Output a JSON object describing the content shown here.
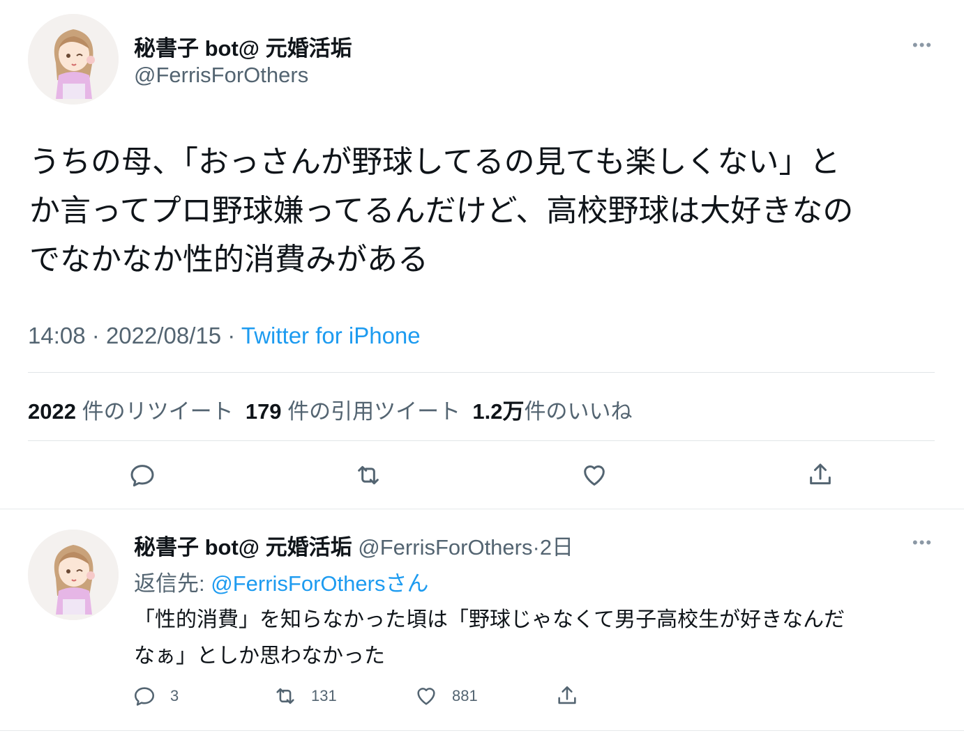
{
  "tweet": {
    "author_name": "秘書子 bot@ 元婚活垢",
    "author_handle": "@FerrisForOthers",
    "more_label": "•••",
    "text_lines": [
      "うちの母、「おっさんが野球してるの見ても楽しくない」と",
      "か言ってプロ野球嫌ってるんだけど、高校野球は大好きなの",
      "でなかなか性的消費みがある"
    ],
    "time": "14:08",
    "date": "2022/08/15",
    "separator": "·",
    "source": "Twitter for iPhone",
    "stats": {
      "retweets_count": "2022",
      "retweets_label": "件のリツイート",
      "quotes_count": "179",
      "quotes_label": "件の引用ツイート",
      "likes_count": "1.2万",
      "likes_label": "件のいいね"
    },
    "actions": {
      "reply_icon": "reply-icon",
      "retweet_icon": "retweet-icon",
      "like_icon": "heart-icon",
      "share_icon": "share-icon"
    }
  },
  "reply": {
    "author_name": "秘書子 bot@ 元婚活垢",
    "author_handle": "@FerrisForOthers",
    "separator": "·",
    "age": "2日",
    "more_label": "•••",
    "reply_to_prefix": "返信先: ",
    "reply_to_handle": "@FerrisForOthers",
    "reply_to_suffix": "さん",
    "text_lines": [
      "「性的消費」を知らなかった頃は「野球じゃなくて男子高校生が好きなんだ",
      "なぁ」としか思わなかった"
    ],
    "reply_count": "3",
    "retweet_count": "131",
    "like_count": "881"
  },
  "colors": {
    "text": "#0f1419",
    "secondary": "#536471",
    "link": "#1d9bf0",
    "divider": "#e1e5e8"
  }
}
